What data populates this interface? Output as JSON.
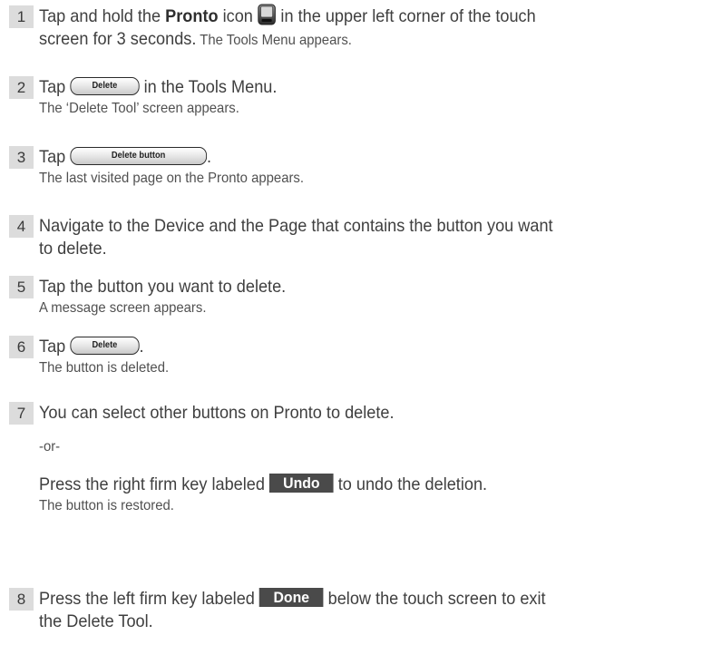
{
  "steps": [
    {
      "number": "1",
      "line1_a": "Tap and hold the ",
      "line1_bold": "Pronto",
      "line1_b": " icon ",
      "line1_c": " in the upper left corner of the touch",
      "line2_a": "screen for 3 seconds.",
      "line2_b": " The Tools Menu appears.",
      "icon": "pronto-remote-icon"
    },
    {
      "number": "2",
      "line1_a": "Tap ",
      "button_label": "Delete",
      "line1_b": " in the Tools Menu.",
      "line2": "The ‘Delete Tool’ screen appears."
    },
    {
      "number": "3",
      "line1_a": "Tap ",
      "button_label": "Delete button",
      "line1_b": ".",
      "line2": "The last visited page on the Pronto appears."
    },
    {
      "number": "4",
      "line1": "Navigate to the Device and the Page that contains the button you want",
      "line2": "to delete."
    },
    {
      "number": "5",
      "line1": "Tap the button you want to delete.",
      "line2": "A message screen appears."
    },
    {
      "number": "6",
      "line1_a": "Tap ",
      "button_label": "Delete",
      "line1_b": ".",
      "line2": "The button is deleted."
    },
    {
      "number": "7",
      "line1": "You can select other buttons on Pronto to delete.",
      "or_text": "-or-",
      "line3_a": "Press the right firm key labeled ",
      "firm_key": "Undo",
      "line3_b": " to undo the deletion.",
      "line4": "The button is restored."
    },
    {
      "number": "8",
      "line1_a": "Press the left firm key labeled ",
      "firm_key": "Done",
      "line1_b": " below the touch screen to exit",
      "line2": "the Delete Tool."
    }
  ]
}
